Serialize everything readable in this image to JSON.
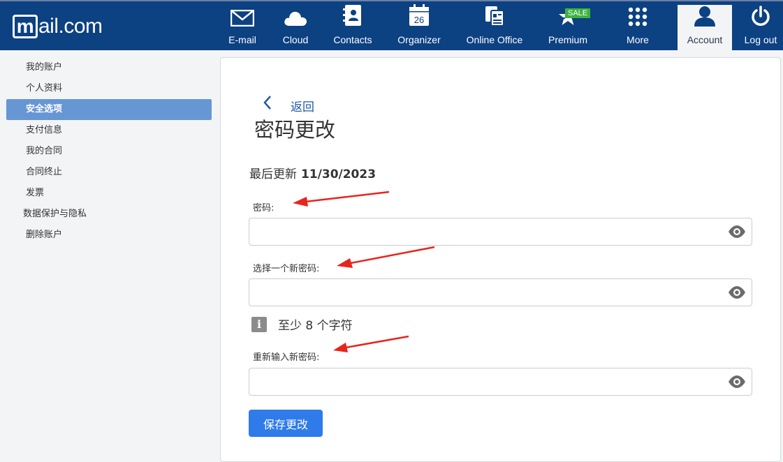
{
  "brand": {
    "logo_text": "ail.com",
    "logo_m": "m"
  },
  "nav": {
    "items": [
      {
        "key": "email",
        "label": "E-mail",
        "icon": "envelope-icon"
      },
      {
        "key": "cloud",
        "label": "Cloud",
        "icon": "cloud-icon"
      },
      {
        "key": "contacts",
        "label": "Contacts",
        "icon": "address-book-icon"
      },
      {
        "key": "organizer",
        "label": "Organizer",
        "icon": "calendar-icon",
        "calendar_day": "26"
      },
      {
        "key": "office",
        "label": "Online Office",
        "icon": "documents-icon"
      },
      {
        "key": "premium",
        "label": "Premium",
        "icon": "star-icon",
        "badge": "SALE"
      },
      {
        "key": "more",
        "label": "More",
        "icon": "grid-icon"
      },
      {
        "key": "account",
        "label": "Account",
        "icon": "user-icon",
        "active": true
      },
      {
        "key": "logout",
        "label": "Log out",
        "icon": "power-icon"
      }
    ]
  },
  "sidebar": {
    "items": [
      {
        "label": "我的账户"
      },
      {
        "label": "个人资料"
      },
      {
        "label": "安全选项",
        "active": true
      },
      {
        "label": "支付信息"
      },
      {
        "label": "我的合同"
      },
      {
        "label": "合同终止"
      },
      {
        "label": "发票"
      },
      {
        "label": "数据保护与隐私"
      },
      {
        "label": "删除账户"
      }
    ]
  },
  "main": {
    "back_label": "返回",
    "title": "密码更改",
    "updated_label": "最后更新",
    "updated_date": "11/30/2023",
    "current_password_label": "密码:",
    "new_password_label": "选择一个新密码:",
    "hint": "至少 8 个字符",
    "confirm_password_label": "重新输入新密码:",
    "save_label": "保存更改"
  },
  "colors": {
    "topbar": "#0c4182",
    "sidebar_active": "#6796d4",
    "primary_button": "#2f7bea",
    "annotation_arrow": "#e8241b"
  }
}
